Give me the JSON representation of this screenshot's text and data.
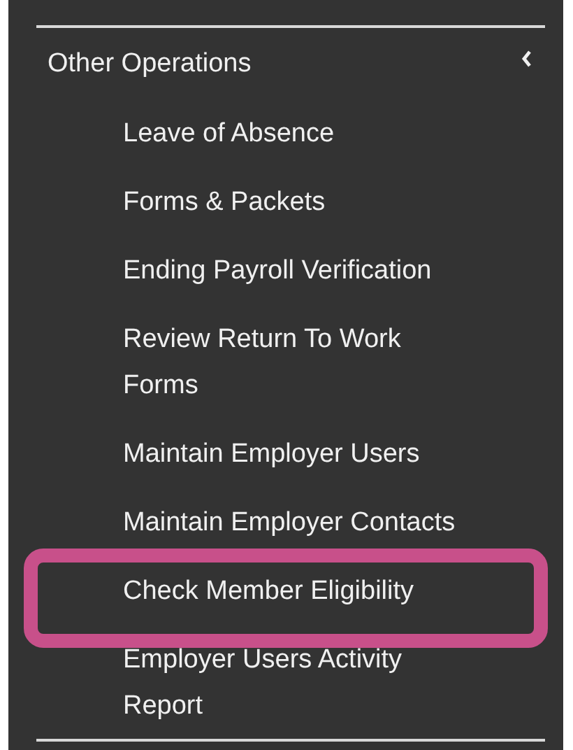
{
  "menu": {
    "title": "Other Operations",
    "expanded": true,
    "items": [
      {
        "label": "Leave of Absence",
        "highlighted": false
      },
      {
        "label": "Forms & Packets",
        "highlighted": false
      },
      {
        "label": "Ending Payroll Verification",
        "highlighted": false
      },
      {
        "label": "Review Return To Work Forms",
        "highlighted": false
      },
      {
        "label": "Maintain Employer Users",
        "highlighted": false
      },
      {
        "label": "Maintain Employer Contacts",
        "highlighted": false
      },
      {
        "label": "Check Member Eligibility",
        "highlighted": true
      },
      {
        "label": "Employer Users Activity Report",
        "highlighted": false
      }
    ]
  }
}
